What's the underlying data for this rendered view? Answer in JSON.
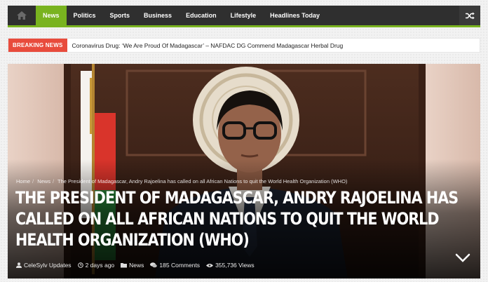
{
  "nav": {
    "items": [
      {
        "label": "News",
        "active": true
      },
      {
        "label": "Politics",
        "active": false
      },
      {
        "label": "Sports",
        "active": false
      },
      {
        "label": "Business",
        "active": false
      },
      {
        "label": "Education",
        "active": false
      },
      {
        "label": "Lifestyle",
        "active": false
      },
      {
        "label": "Headlines Today",
        "active": false
      }
    ],
    "home_icon": "home-icon",
    "shuffle_icon": "shuffle-icon",
    "accent": "#79b31f",
    "bar_color": "#2f2f2f"
  },
  "breaking": {
    "label": "BREAKING NEWS",
    "text": "Coronavirus Drug: ‘We Are Proud Of Madagascar’ – NAFDAC DG Commend Madagascar Herbal Drug",
    "label_color": "#e84b3c"
  },
  "article": {
    "breadcrumb": [
      "Home",
      "News",
      "The President of Madagascar, Andry Rajoelina has called on all African Nations to quit the World Health Organization (WHO)"
    ],
    "title": "The President of Madagascar, Andry Rajoelina has called on all African Nations to quit the World Health Organization (WHO)",
    "author": "CeleSylv Updates",
    "date": "2 days ago",
    "category": "News",
    "comments": "185 Comments",
    "views": "355,736 Views",
    "scroll_icon": "chevron-down-icon"
  }
}
